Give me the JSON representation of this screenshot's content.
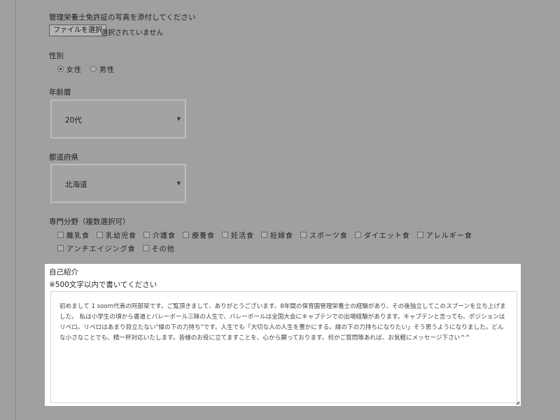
{
  "photo": {
    "label": "管理栄養士免許証の写真を添付してください",
    "button_label": "ファイルを選択",
    "status": "選択されていません"
  },
  "gender": {
    "label": "性別",
    "options": [
      {
        "label": "女性",
        "selected": true
      },
      {
        "label": "男性",
        "selected": false
      }
    ]
  },
  "age": {
    "label": "年齢層",
    "value": "20代"
  },
  "prefecture": {
    "label": "都道府県",
    "value": "北海道"
  },
  "specialty": {
    "label": "専門分野（複数選択可）",
    "row1": [
      "離乳食",
      "乳幼児食",
      "介護食",
      "療養食",
      "妊活食",
      "妊婦食",
      "スポーツ食",
      "ダイエット食",
      "アレルギー食"
    ],
    "row2": [
      "アンチエイジング食",
      "その他"
    ]
  },
  "intro": {
    "title": "自己紹介",
    "note": "※500文字以内で書いてください",
    "text": "初めまして 1 soom代表の阿部栞です。ご覧頂きまして、ありがとうございます。8年間の保育園管理栄養士の経験があり、その後独立してこのスプーンを立ち上げました。 私は小学生の頃から書道とバレーボール三昧の人生で、バレーボールは全国大会にキャプテンでの出場経験があります。キャプテンと言っても、ポジションはリベロ。リベロはあまり目立たない\"縁の下の力持ち\"です。人生でも「大切な人の人生を豊かにする。縁の下の力持ちになりたい」そう思うようになりました。どんな小さなことでも、精一杯対応いたします。皆様のお役に立てますことを、心から願っております。何かご質問等あれば、お気軽にメッセージ下さい^^"
  }
}
